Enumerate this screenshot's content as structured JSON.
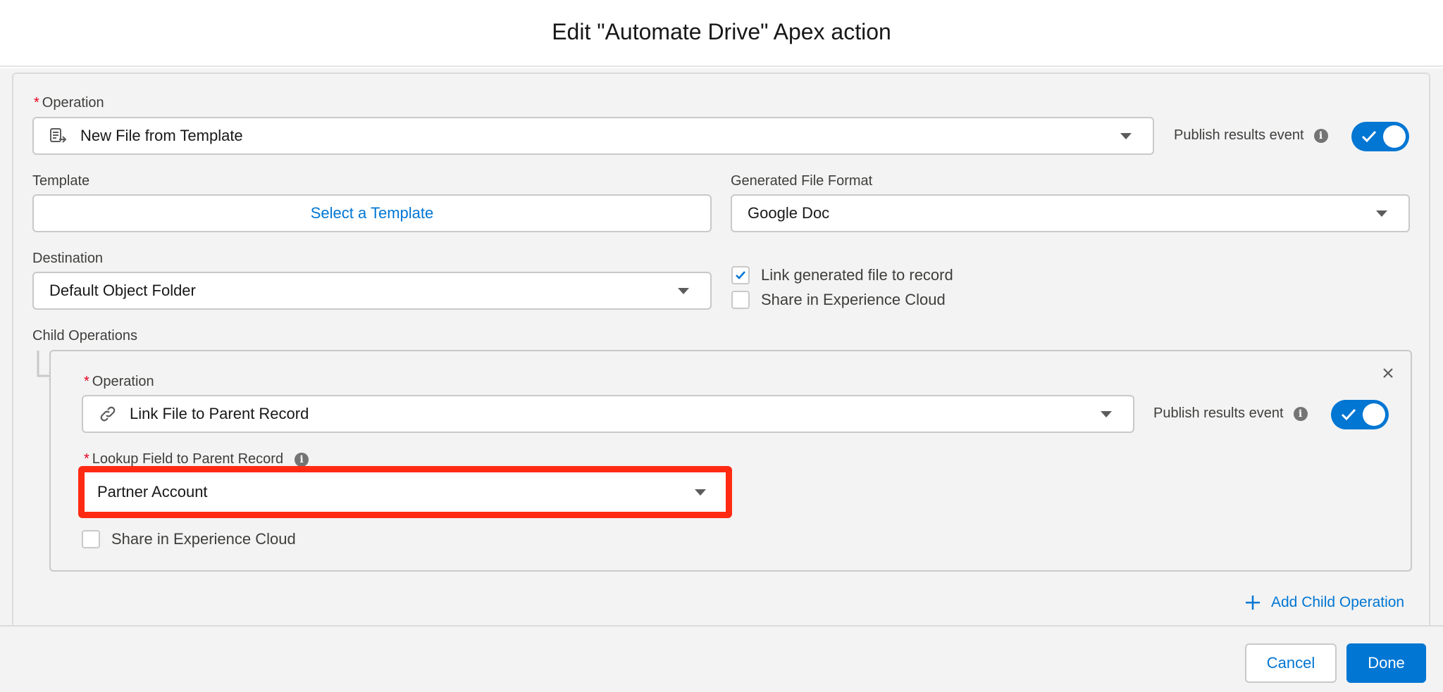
{
  "modal": {
    "title": "Edit \"Automate Drive\" Apex action"
  },
  "operation": {
    "label": "Operation",
    "required_mark": "*",
    "value": "New File from Template",
    "icon": "document-template-icon",
    "publish_label": "Publish results event",
    "publish_on": true
  },
  "template": {
    "label": "Template",
    "button": "Select a Template"
  },
  "file_format": {
    "label": "Generated File Format",
    "value": "Google Doc"
  },
  "destination": {
    "label": "Destination",
    "value": "Default Object Folder"
  },
  "options": {
    "link_file": {
      "label": "Link generated file to record",
      "checked": true
    },
    "share_cloud": {
      "label": "Share in Experience Cloud",
      "checked": false
    }
  },
  "child_operations": {
    "label": "Child Operations",
    "items": [
      {
        "operation_label": "Operation",
        "required_mark": "*",
        "operation_value": "Link File to Parent Record",
        "icon": "link-icon",
        "publish_label": "Publish results event",
        "publish_on": true,
        "lookup_label": "Lookup Field to Parent Record",
        "lookup_value": "Partner Account",
        "share_label": "Share in Experience Cloud",
        "share_checked": false
      }
    ],
    "add_label": "Add Child Operation"
  },
  "footer": {
    "cancel": "Cancel",
    "done": "Done"
  },
  "colors": {
    "brand": "#0176d3",
    "highlight": "#ff2a12",
    "required": "#ea001e"
  }
}
